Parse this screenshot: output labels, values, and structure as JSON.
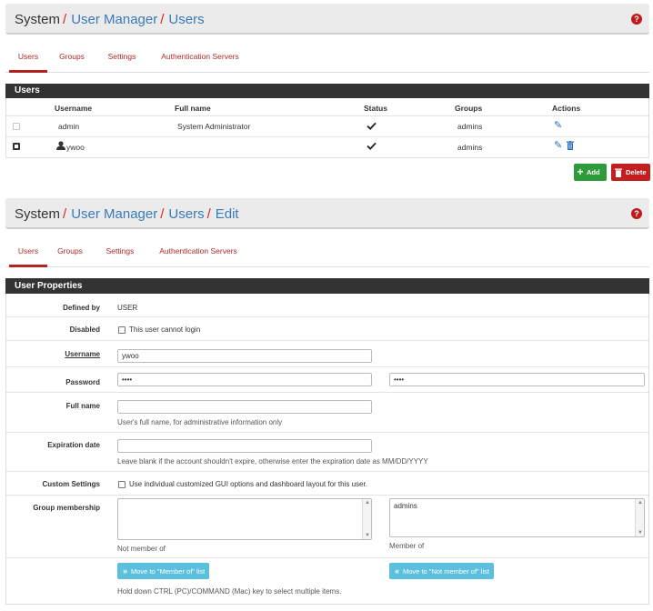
{
  "top": {
    "breadcrumb": {
      "system": "System",
      "sep1": "/",
      "user_manager": "User Manager",
      "sep2": "/",
      "users": "Users"
    },
    "help": "?",
    "tabs": [
      "Users",
      "Groups",
      "Settings",
      "Authentication Servers"
    ],
    "panel_title": "Users",
    "columns": {
      "username": "Username",
      "fullname": "Full name",
      "status": "Status",
      "groups": "Groups",
      "actions": "Actions"
    },
    "rows": [
      {
        "username": "admin",
        "fullname": "System Administrator",
        "groups": "admins"
      },
      {
        "username": "ywoo",
        "fullname": "",
        "groups": "admins"
      }
    ],
    "add_label": "Add",
    "delete_label": "Delete"
  },
  "edit": {
    "breadcrumb": {
      "system": "System",
      "sep1": "/",
      "user_manager": "User Manager",
      "sep2": "/",
      "users": "Users",
      "sep3": "/",
      "edit": "Edit"
    },
    "help": "?",
    "tabs": [
      "Users",
      "Groups",
      "Settings",
      "Authentication Servers"
    ],
    "panel_title": "User Properties",
    "defined_by_label": "Defined by",
    "defined_by_value": "USER",
    "disabled_label": "Disabled",
    "disabled_text": "This user cannot login",
    "username_label": "Username",
    "username_value": "ywoo",
    "password_label": "Password",
    "password_value": "••••",
    "password_confirm_value": "••••",
    "fullname_label": "Full name",
    "fullname_value": "",
    "fullname_help": "User's full name, for administrative information only",
    "expiration_label": "Expiration date",
    "expiration_value": "",
    "expiration_help": "Leave blank if the account shouldn't expire, otherwise enter the expiration date as MM/DD/YYYY",
    "custom_label": "Custom Settings",
    "custom_text": "Use individual customized GUI options and dashboard layout for this user.",
    "group_label": "Group membership",
    "not_member_caption": "Not member of",
    "member_caption": "Member of",
    "member_items": [
      "admins"
    ],
    "move_to_member": "Move to \"Member of\" list",
    "move_to_not_member": "Move to \"Not member of\" list",
    "hold_help": "Hold down CTRL (PC)/COMMAND (Mac) key to select multiple items."
  },
  "colors": {
    "link": "#3a7ab8",
    "accent": "#b22222",
    "panel_head": "#333333",
    "green": "#2e9c3b",
    "red": "#c41f1f",
    "info": "#5bc0de"
  },
  "icons": [
    "help-icon",
    "pencil-icon",
    "trash-icon",
    "user-icon",
    "check-icon",
    "plus-icon",
    "double-chevron-right-icon",
    "double-chevron-left-icon"
  ]
}
